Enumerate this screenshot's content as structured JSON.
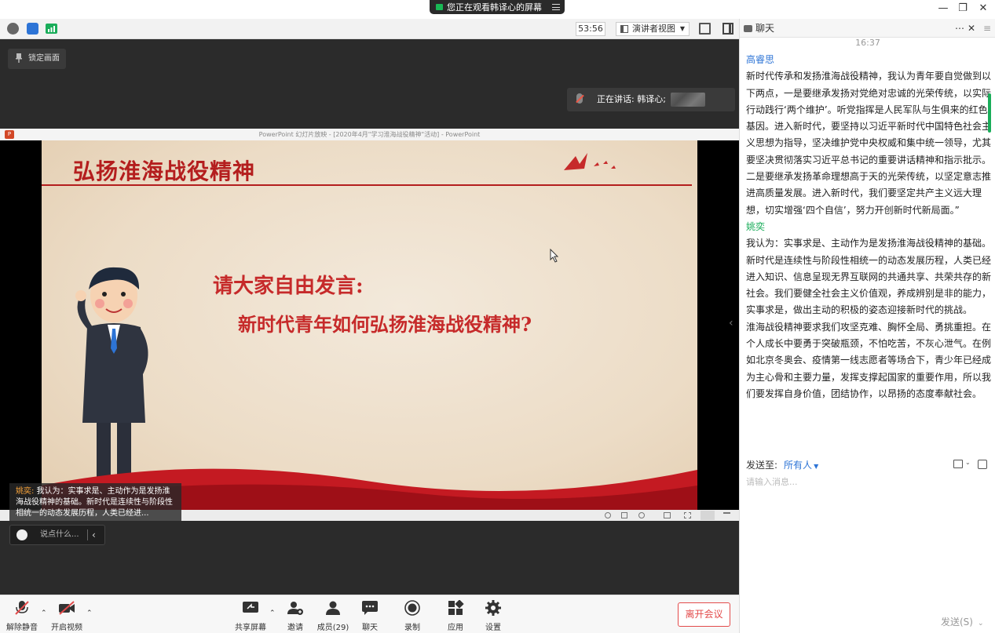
{
  "banner": {
    "text": "您正在观看韩译心的屏幕"
  },
  "toolbar": {
    "timer": "53:56",
    "view_mode": "演讲者视图"
  },
  "stage": {
    "lock_label": "锁定画面",
    "speaking_label": "正在讲话: 韩译心;"
  },
  "ppt": {
    "window_title": "PowerPoint 幻灯片放映 - [2020年4月\"学习淮海战役精神\"活动] - PowerPoint",
    "slide_title": "弘扬淮海战役精神",
    "slide_q1": "请大家自由发言:",
    "slide_q2": "新时代青年如何弘扬淮海战役精神?"
  },
  "caption": {
    "name": "姚奕:",
    "text": " 我认为：实事求是、主动作为是发扬淮海战役精神的基础。新时代是连续性与阶段性相统一的动态发展历程，人类已经进..."
  },
  "chat_input": {
    "placeholder": "说点什么..."
  },
  "bottom": {
    "mute": "解除静音",
    "video": "开启视频",
    "share": "共享屏幕",
    "invite": "邀请",
    "members": "成员(29)",
    "chat": "聊天",
    "record": "录制",
    "apps": "应用",
    "settings": "设置",
    "leave": "离开会议"
  },
  "chat": {
    "title": "聊天",
    "timestamp": "16:37",
    "messages": [
      {
        "name": "高睿思",
        "text": "新时代传承和发扬淮海战役精神，我认为青年要自觉做到以下两点，一是要继承发扬对党绝对忠诚的光荣传统，以实际行动践行‘两个维护’。听党指挥是人民军队与生俱来的红色基因。进入新时代，要坚持以习近平新时代中国特色社会主义思想为指导，坚决维护党中央权威和集中统一领导，尤其要坚决贯彻落实习近平总书记的重要讲话精神和指示批示。二是要继承发扬革命理想高于天的光荣传统，以坚定意志推进高质量发展。进入新时代，我们要坚定共产主义远大理想，切实增强‘四个自信’，努力开创新时代新局面。”"
      },
      {
        "name": "姚奕",
        "text": "我认为：实事求是、主动作为是发扬淮海战役精神的基础。新时代是连续性与阶段性相统一的动态发展历程，人类已经进入知识、信息呈现无界互联网的共通共享、共荣共存的新社会。我们要健全社会主义价值观，养成辨别是非的能力，实事求是，做出主动的积极的姿态迎接新时代的挑战。",
        "text2": "淮海战役精神要求我们攻坚克难、胸怀全局、勇挑重担。在个人成长中要勇于突破瓶颈，不怕吃苦，不灰心泄气。在例如北京冬奥会、疫情第一线志愿者等场合下，青少年已经成为主心骨和主要力量，发挥支撑起国家的重要作用，所以我们要发挥自身价值，团结协作，以昂扬的态度奉献社会。"
      }
    ],
    "send_to_label": "发送至:",
    "send_to_value": "所有人",
    "input_placeholder": "请输入消息...",
    "send_button": "发送(S)"
  }
}
